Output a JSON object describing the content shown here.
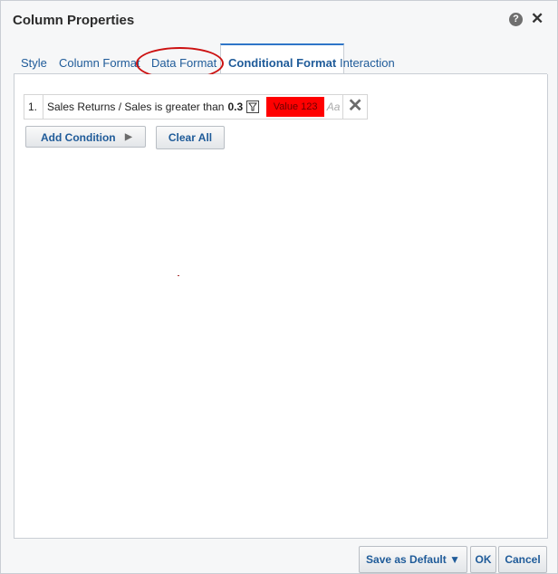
{
  "dialog": {
    "title": "Column Properties",
    "help_icon": "question-circle-icon",
    "close_icon": "close-icon"
  },
  "tabs": [
    {
      "label": "Style",
      "active": false
    },
    {
      "label": "Column Format",
      "active": false
    },
    {
      "label": "Data Format",
      "active": false,
      "highlighted": true
    },
    {
      "label": "Conditional Format",
      "active": true
    },
    {
      "label": "Interaction",
      "active": false
    }
  ],
  "condition": {
    "number": "1.",
    "text": "Sales Returns / Sales is greater than",
    "value": "0.3",
    "filter_icon": "filter-icon",
    "preview_text": "Value 123",
    "preview_bg": "#ff0000",
    "font_icon_text": "Aa",
    "delete_icon": "delete-x-icon"
  },
  "buttons": {
    "add_condition": "Add Condition",
    "clear_all": "Clear All"
  },
  "footer": {
    "save_default": "Save as Default",
    "ok": "OK",
    "cancel": "Cancel"
  },
  "colors": {
    "accent": "#1f5b99",
    "highlight_circle": "#cc1111"
  }
}
